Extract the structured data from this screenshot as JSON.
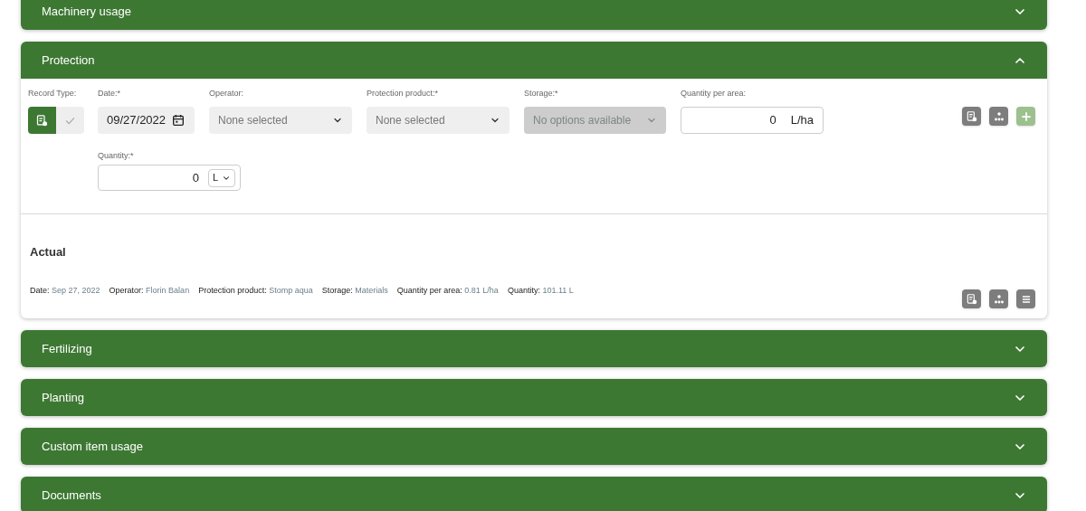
{
  "sections": [
    {
      "title": "Machinery usage",
      "expanded": false
    },
    {
      "title": "Protection",
      "expanded": true,
      "form": {
        "record_type": {
          "label": "Record Type:",
          "options": [
            {
              "selected": true
            },
            {
              "selected": false
            }
          ]
        },
        "fields": [
          {
            "kind": "date",
            "label": "Date:*",
            "value": "09/27/2022"
          },
          {
            "kind": "select",
            "label": "Operator:",
            "placeholder": "None selected",
            "disabled": false
          },
          {
            "kind": "select",
            "label": "Protection product:*",
            "placeholder": "None selected",
            "disabled": false
          },
          {
            "kind": "select",
            "label": "Storage:*",
            "placeholder": "No options available",
            "disabled": true
          },
          {
            "kind": "number",
            "label": "Quantity per area:",
            "value": "0",
            "unit": "L/ha"
          }
        ],
        "quantity": {
          "label": "Quantity:*",
          "value": "0",
          "unit": "L"
        },
        "actual": {
          "title": "Actual",
          "details": [
            {
              "label": "Date:",
              "value": "Sep 27, 2022"
            },
            {
              "label": "Operator:",
              "value": "Florin Balan"
            },
            {
              "label": "Protection product:",
              "value": "Stomp aqua"
            },
            {
              "label": "Storage:",
              "value": "Materials"
            },
            {
              "label": "Quantity per area:",
              "value": "0.81 L/ha"
            },
            {
              "label": "Quantity:",
              "value": "101.11 L"
            }
          ]
        }
      }
    },
    {
      "title": "Fertilizing",
      "expanded": false
    },
    {
      "title": "Planting",
      "expanded": false
    },
    {
      "title": "Custom item usage",
      "expanded": false
    },
    {
      "title": "Documents",
      "expanded": false
    }
  ]
}
